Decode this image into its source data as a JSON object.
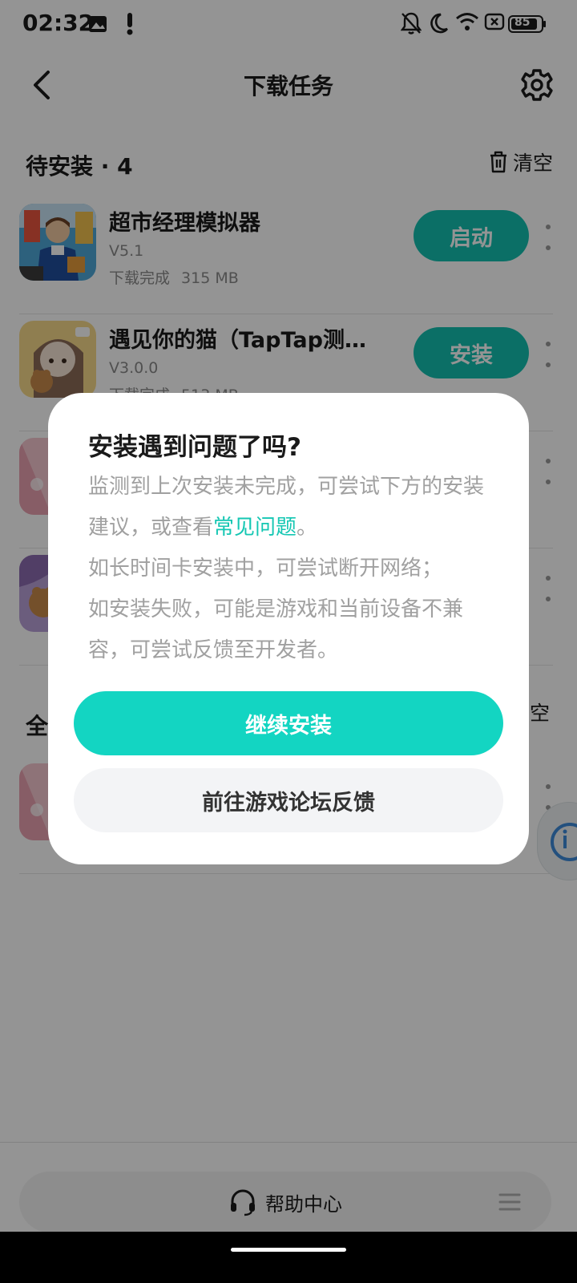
{
  "status_bar": {
    "time": "02:32",
    "battery": "85",
    "icons": [
      "gallery-icon",
      "alert-icon",
      "mute-icon",
      "moon-icon",
      "wifi-icon",
      "battery-icon"
    ]
  },
  "header": {
    "title": "下载任务",
    "back_icon": "chevron-left-icon",
    "settings_icon": "gear-icon"
  },
  "pending": {
    "title": "待安装 · 4",
    "clear_label": "清空",
    "items": [
      {
        "name": "超市经理模拟器",
        "version": "V5.1",
        "status": "下载完成",
        "size": "315 MB",
        "action": "启动"
      },
      {
        "name": "遇见你的猫（TapTap测试...",
        "version": "V3.0.0",
        "status": "下载完成",
        "size": "513 MB",
        "action": "安装"
      }
    ]
  },
  "all_section": {
    "title_partial": "全",
    "clear_partial": "清空"
  },
  "dialog": {
    "title": "安装遇到问题了吗?",
    "body_prefix": "监测到上次安装未完成，可尝试下方的安装建议，或查看",
    "faq_link": "常见问题",
    "body_suffix": "。",
    "line2": "如长时间卡安装中，可尝试断开网络；",
    "line3": "如安装失败，可能是游戏和当前设备不兼容，可尝试反馈至开发者。",
    "primary_button": "继续安装",
    "secondary_button": "前往游戏论坛反馈"
  },
  "bottom": {
    "help_label": "帮助中心",
    "help_icon": "headset-icon",
    "menu_icon": "hamburger-icon"
  },
  "colors": {
    "accent": "#14c0b0",
    "dialog_primary": "#13d5c2",
    "link": "#15c7b3",
    "overlay": "rgba(0,0,0,0.42)"
  }
}
